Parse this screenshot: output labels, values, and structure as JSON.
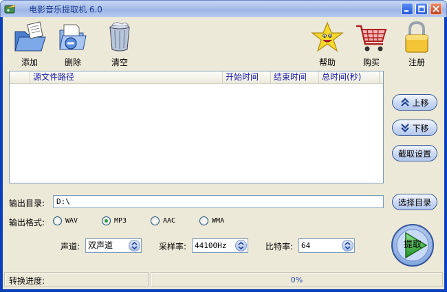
{
  "window": {
    "title": "电影音乐提取机 6.0"
  },
  "toolbar": {
    "add": "添加",
    "delete": "删除",
    "clear": "清空",
    "help": "帮助",
    "buy": "购买",
    "register": "注册"
  },
  "filelist": {
    "columns": [
      "源文件路径",
      "开始时间",
      "结束时间",
      "总时间(秒)"
    ],
    "rows": []
  },
  "side": {
    "move_up": "上移",
    "move_down": "下移",
    "trim_settings": "截取设置",
    "choose_dir": "选择目录"
  },
  "output": {
    "dir_label": "输出目录:",
    "dir_value": "D:\\",
    "format_label": "输出格式:",
    "formats": [
      "WAV",
      "MP3",
      "AAC",
      "WMA"
    ],
    "selected_format": "MP3"
  },
  "settings": {
    "channel_label": "声道:",
    "channel_value": "双声道",
    "samplerate_label": "采样率:",
    "samplerate_value": "44100Hz",
    "bitrate_label": "比特率:",
    "bitrate_value": "64"
  },
  "extract_button": "提取",
  "status": {
    "progress_label": "转换进度:",
    "progress_value": "0%"
  },
  "colors": {
    "titlebar": "#aac0ea",
    "client": "#ece9d8",
    "accent_blue": "#0a3fbd",
    "extract_green": "#2ea82e"
  }
}
